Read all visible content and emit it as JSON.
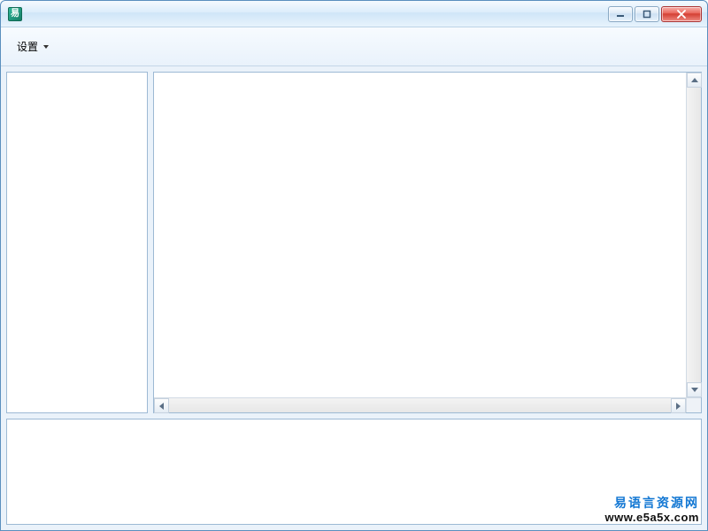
{
  "window": {
    "title": ""
  },
  "menubar": {
    "settings_label": "设置"
  },
  "watermark": {
    "line1": "易语言资源网",
    "line2": "www.e5a5x.com"
  }
}
